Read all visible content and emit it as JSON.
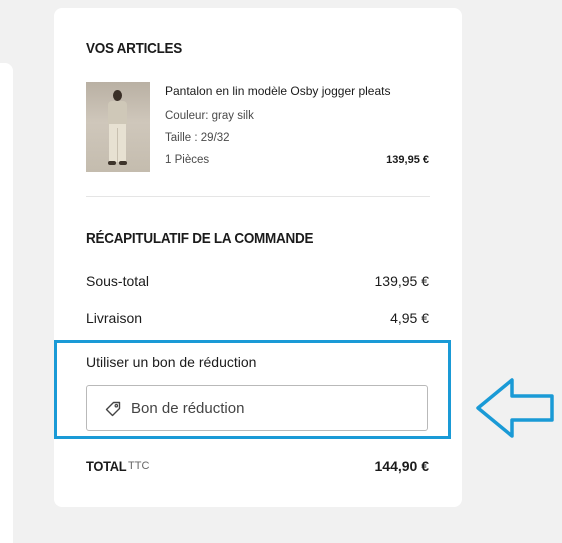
{
  "articles": {
    "title": "VOS ARTICLES",
    "product": {
      "name": "Pantalon en lin modèle Osby jogger pleats",
      "color": "Couleur: gray silk",
      "size": "Taille : 29/32",
      "quantity": "1 Pièces",
      "price": "139,95 €"
    }
  },
  "summary": {
    "title": "RÉCAPITULATIF DE LA COMMANDE",
    "subtotal_label": "Sous-total",
    "subtotal_value": "139,95 €",
    "shipping_label": "Livraison",
    "shipping_value": "4,95 €"
  },
  "coupon": {
    "label": "Utiliser un bon de réduction",
    "placeholder": "Bon de réduction",
    "icon": "tag-icon"
  },
  "total": {
    "label": "TOTAL",
    "suffix": "TTC",
    "value": "144,90 €"
  },
  "annotation": {
    "highlight_color": "#1a9ad6",
    "arrow_icon": "arrow-left-icon"
  }
}
